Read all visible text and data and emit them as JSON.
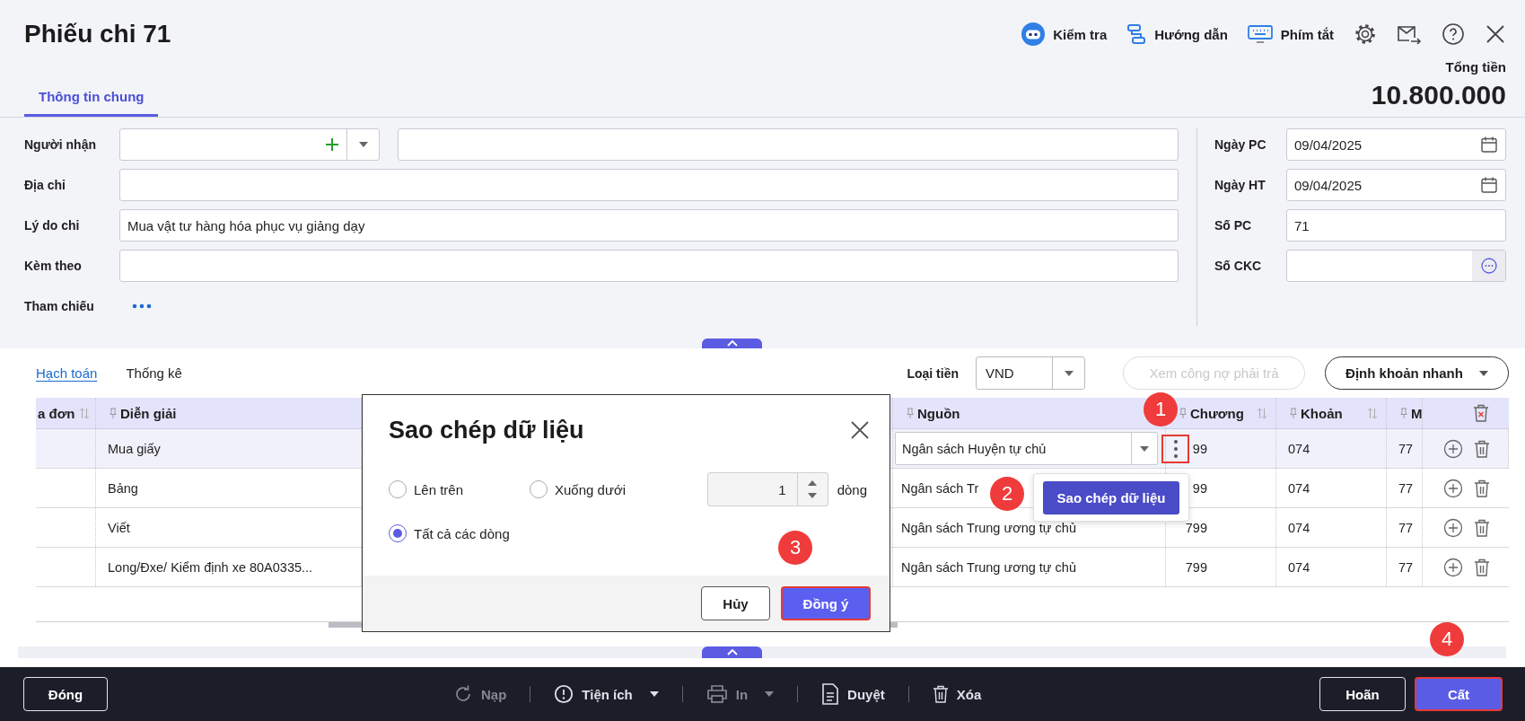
{
  "header": {
    "title": "Phiếu chi 71",
    "actions": [
      {
        "label": "Kiểm tra"
      },
      {
        "label": "Hướng dẫn"
      },
      {
        "label": "Phím tắt"
      }
    ],
    "tabs": [
      {
        "label": "Thông tin chung",
        "selected": true
      }
    ],
    "total": {
      "label": "Tổng tiền",
      "value": "10.800.000"
    }
  },
  "form": {
    "left": [
      {
        "label": "Người nhận",
        "kind": "partner"
      },
      {
        "label": "Địa chỉ",
        "kind": "text"
      },
      {
        "label": "Lý do chi",
        "kind": "text",
        "value": "Mua vật tư hàng hóa phục vụ giảng dạy"
      },
      {
        "label": "Kèm theo",
        "kind": "text"
      },
      {
        "label": "Tham chiếu",
        "kind": "more"
      }
    ],
    "right": [
      {
        "label": "Ngày PC",
        "kind": "date",
        "value": "09/04/2025"
      },
      {
        "label": "Ngày HT",
        "kind": "date",
        "value": "09/04/2025"
      },
      {
        "label": "Số PC",
        "kind": "text",
        "value": "71"
      },
      {
        "label": "Số CKC",
        "kind": "picker"
      }
    ]
  },
  "grid": {
    "tabs": [
      {
        "label": "Hạch toán",
        "selected": true
      },
      {
        "label": "Thống kê",
        "selected": false
      }
    ],
    "currency": {
      "label": "Loại tiền",
      "value": "VND"
    },
    "buttons": [
      {
        "label": "Xem công nợ phải trả",
        "disabled": true,
        "dropdown": false
      },
      {
        "label": "Định khoản nhanh",
        "disabled": false,
        "dropdown": true
      }
    ],
    "columns": [
      {
        "label": "a đơn",
        "pinned": false,
        "sortable": true
      },
      {
        "label": "Diễn giải",
        "pinned": true,
        "sortable": false
      },
      {
        "label": "Nguồn",
        "pinned": true,
        "sortable": false
      },
      {
        "label": "Chương",
        "pinned": true,
        "sortable": true
      },
      {
        "label": "Khoản",
        "pinned": true,
        "sortable": true
      },
      {
        "label": "M",
        "pinned": true,
        "sortable": false
      }
    ],
    "rows": [
      {
        "selected": true,
        "description": "Mua giấy",
        "source": "Ngân sách Huyện tự chủ",
        "chapter": "99",
        "item": "074",
        "column_6": "77"
      },
      {
        "selected": false,
        "description": "Bảng",
        "source": "Ngân sách Tr",
        "chapter": "99",
        "item": "074",
        "column_6": "77"
      },
      {
        "selected": false,
        "description": "Viết",
        "source": "Ngân sách Trung ương tự chủ",
        "chapter": "799",
        "item": "074",
        "column_6": "77"
      },
      {
        "selected": false,
        "description": "Long/Đxe/ Kiểm định xe 80A0335...",
        "source": "Ngân sách Trung ương tự chủ",
        "chapter": "799",
        "item": "074",
        "column_6": "77"
      }
    ],
    "more_button": {
      "highlighted": true
    }
  },
  "context_menu": {
    "items": [
      {
        "label": "Sao chép dữ liệu"
      }
    ]
  },
  "copy_dialog": {
    "title": "Sao chép dữ liệu",
    "options": [
      {
        "label": "Lên trên",
        "selected": false
      },
      {
        "label": "Xuống dưới",
        "selected": false
      },
      {
        "label": "Tất cả các dòng",
        "selected": true
      }
    ],
    "count": {
      "value": "1",
      "unit": "dòng"
    },
    "buttons": [
      {
        "label": "Hủy",
        "kind": "secondary",
        "highlighted": false
      },
      {
        "label": "Đồng ý",
        "kind": "primary",
        "highlighted": true
      }
    ]
  },
  "step_markers": [
    {
      "label": "1"
    },
    {
      "label": "2"
    },
    {
      "label": "3"
    },
    {
      "label": "4"
    }
  ],
  "bottom_bar": {
    "close": {
      "label": "Đóng"
    },
    "tools": [
      {
        "label": "Nạp",
        "disabled": true,
        "dropdown": false
      },
      {
        "label": "Tiện ích",
        "disabled": false,
        "dropdown": true
      },
      {
        "label": "In",
        "disabled": true,
        "dropdown": true
      },
      {
        "label": "Duyệt",
        "disabled": false,
        "dropdown": false
      },
      {
        "label": "Xóa",
        "disabled": false,
        "dropdown": false
      }
    ],
    "actions": [
      {
        "label": "Hoãn",
        "kind": "secondary",
        "highlighted": false
      },
      {
        "label": "Cất",
        "kind": "primary",
        "highlighted": true
      }
    ]
  }
}
